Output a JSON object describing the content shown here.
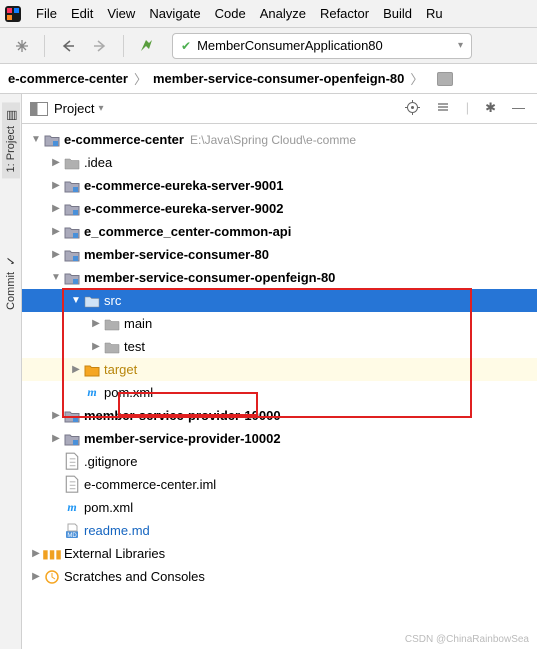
{
  "menu": {
    "items": [
      "File",
      "Edit",
      "View",
      "Navigate",
      "Code",
      "Analyze",
      "Refactor",
      "Build",
      "Ru"
    ]
  },
  "toolbar": {
    "run_config": "MemberConsumerApplication80"
  },
  "breadcrumb": {
    "a": "e-commerce-center",
    "b": "member-service-consumer-openfeign-80"
  },
  "gutter": {
    "project": "1: Project",
    "commit": "Commit"
  },
  "panel": {
    "title": "Project"
  },
  "tree": [
    {
      "depth": 0,
      "icon": "module",
      "label": "e-commerce-center",
      "bold": true,
      "hint": "E:\\Java\\Spring Cloud\\e-comme",
      "exp": "down"
    },
    {
      "depth": 1,
      "icon": "folder",
      "label": ".idea",
      "exp": "right"
    },
    {
      "depth": 1,
      "icon": "module",
      "label": "e-commerce-eureka-server-9001",
      "bold": true,
      "exp": "right"
    },
    {
      "depth": 1,
      "icon": "module",
      "label": "e-commerce-eureka-server-9002",
      "bold": true,
      "exp": "right"
    },
    {
      "depth": 1,
      "icon": "module",
      "label": "e_commerce_center-common-api",
      "bold": true,
      "exp": "right"
    },
    {
      "depth": 1,
      "icon": "module",
      "label": "member-service-consumer-80",
      "bold": true,
      "exp": "right"
    },
    {
      "depth": 1,
      "icon": "module",
      "label": "member-service-consumer-openfeign-80",
      "bold": true,
      "exp": "down"
    },
    {
      "depth": 2,
      "icon": "folder",
      "label": "src",
      "exp": "down",
      "selected": true
    },
    {
      "depth": 3,
      "icon": "folder",
      "label": "main",
      "exp": "right"
    },
    {
      "depth": 3,
      "icon": "folder",
      "label": "test",
      "exp": "right"
    },
    {
      "depth": 2,
      "icon": "target",
      "label": "target",
      "exp": "right",
      "highlight": true
    },
    {
      "depth": 2,
      "icon": "m",
      "label": "pom.xml"
    },
    {
      "depth": 1,
      "icon": "module",
      "label": "member-service-provider-10000",
      "bold": true,
      "exp": "right"
    },
    {
      "depth": 1,
      "icon": "module",
      "label": "member-service-provider-10002",
      "bold": true,
      "exp": "right"
    },
    {
      "depth": 1,
      "icon": "file",
      "label": ".gitignore"
    },
    {
      "depth": 1,
      "icon": "file",
      "label": "e-commerce-center.iml"
    },
    {
      "depth": 1,
      "icon": "m",
      "label": "pom.xml"
    },
    {
      "depth": 1,
      "icon": "md",
      "label": "readme.md",
      "color": "#1565c0"
    },
    {
      "depth": 0,
      "icon": "lib",
      "label": "External Libraries",
      "exp": "right"
    },
    {
      "depth": 0,
      "icon": "scratch",
      "label": "Scratches and Consoles",
      "exp": "right"
    }
  ],
  "watermark": "CSDN @ChinaRainbowSea"
}
